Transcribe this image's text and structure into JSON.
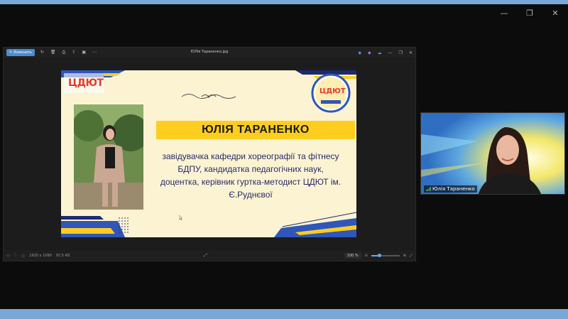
{
  "window_controls": {
    "minimize": "—",
    "restore": "❐",
    "close": "✕"
  },
  "viewer": {
    "edit_label": "Изменить",
    "file_title": "ЮЛія Тараненко.jpg",
    "status_left_1": "1920 x 1080",
    "status_left_2": "97,5 КБ",
    "zoom_value": "100 %",
    "zoom_fraction": 0.3
  },
  "slide": {
    "logo_left_text": "ЦДЮТ",
    "logo_right_text": "ЦДЮТ",
    "name": "ЮЛІЯ ТАРАНЕНКО",
    "description_lines": [
      "завідувачка кафедри хореографії та фітнесу",
      "БДПУ, кандидатка педагогічних наук,",
      "доцентка, керівник гуртка-методист ЦДЮТ ім.",
      "Є.Руднєвої"
    ]
  },
  "webcam": {
    "participant_name": "Юлія Тараненко"
  },
  "colors": {
    "accent_blue": "#4b8ed1",
    "slide_bg": "#fbf3d2",
    "name_bar": "#ffcd1f",
    "text_navy": "#2b2b6a"
  }
}
